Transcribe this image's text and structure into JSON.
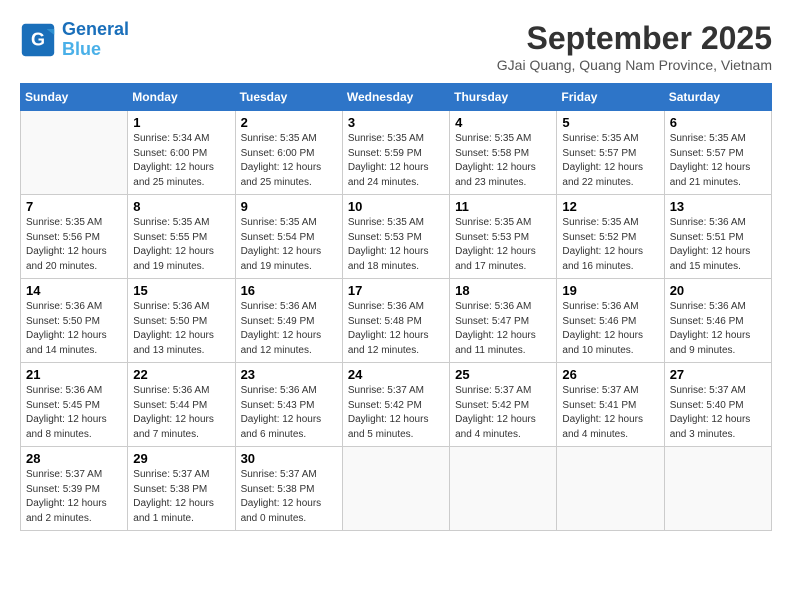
{
  "header": {
    "logo_line1": "General",
    "logo_line2": "Blue",
    "month_title": "September 2025",
    "subtitle": "GJai Quang, Quang Nam Province, Vietnam"
  },
  "days_of_week": [
    "Sunday",
    "Monday",
    "Tuesday",
    "Wednesday",
    "Thursday",
    "Friday",
    "Saturday"
  ],
  "weeks": [
    [
      {
        "day": "",
        "info": ""
      },
      {
        "day": "1",
        "info": "Sunrise: 5:34 AM\nSunset: 6:00 PM\nDaylight: 12 hours\nand 25 minutes."
      },
      {
        "day": "2",
        "info": "Sunrise: 5:35 AM\nSunset: 6:00 PM\nDaylight: 12 hours\nand 25 minutes."
      },
      {
        "day": "3",
        "info": "Sunrise: 5:35 AM\nSunset: 5:59 PM\nDaylight: 12 hours\nand 24 minutes."
      },
      {
        "day": "4",
        "info": "Sunrise: 5:35 AM\nSunset: 5:58 PM\nDaylight: 12 hours\nand 23 minutes."
      },
      {
        "day": "5",
        "info": "Sunrise: 5:35 AM\nSunset: 5:57 PM\nDaylight: 12 hours\nand 22 minutes."
      },
      {
        "day": "6",
        "info": "Sunrise: 5:35 AM\nSunset: 5:57 PM\nDaylight: 12 hours\nand 21 minutes."
      }
    ],
    [
      {
        "day": "7",
        "info": "Sunrise: 5:35 AM\nSunset: 5:56 PM\nDaylight: 12 hours\nand 20 minutes."
      },
      {
        "day": "8",
        "info": "Sunrise: 5:35 AM\nSunset: 5:55 PM\nDaylight: 12 hours\nand 19 minutes."
      },
      {
        "day": "9",
        "info": "Sunrise: 5:35 AM\nSunset: 5:54 PM\nDaylight: 12 hours\nand 19 minutes."
      },
      {
        "day": "10",
        "info": "Sunrise: 5:35 AM\nSunset: 5:53 PM\nDaylight: 12 hours\nand 18 minutes."
      },
      {
        "day": "11",
        "info": "Sunrise: 5:35 AM\nSunset: 5:53 PM\nDaylight: 12 hours\nand 17 minutes."
      },
      {
        "day": "12",
        "info": "Sunrise: 5:35 AM\nSunset: 5:52 PM\nDaylight: 12 hours\nand 16 minutes."
      },
      {
        "day": "13",
        "info": "Sunrise: 5:36 AM\nSunset: 5:51 PM\nDaylight: 12 hours\nand 15 minutes."
      }
    ],
    [
      {
        "day": "14",
        "info": "Sunrise: 5:36 AM\nSunset: 5:50 PM\nDaylight: 12 hours\nand 14 minutes."
      },
      {
        "day": "15",
        "info": "Sunrise: 5:36 AM\nSunset: 5:50 PM\nDaylight: 12 hours\nand 13 minutes."
      },
      {
        "day": "16",
        "info": "Sunrise: 5:36 AM\nSunset: 5:49 PM\nDaylight: 12 hours\nand 12 minutes."
      },
      {
        "day": "17",
        "info": "Sunrise: 5:36 AM\nSunset: 5:48 PM\nDaylight: 12 hours\nand 12 minutes."
      },
      {
        "day": "18",
        "info": "Sunrise: 5:36 AM\nSunset: 5:47 PM\nDaylight: 12 hours\nand 11 minutes."
      },
      {
        "day": "19",
        "info": "Sunrise: 5:36 AM\nSunset: 5:46 PM\nDaylight: 12 hours\nand 10 minutes."
      },
      {
        "day": "20",
        "info": "Sunrise: 5:36 AM\nSunset: 5:46 PM\nDaylight: 12 hours\nand 9 minutes."
      }
    ],
    [
      {
        "day": "21",
        "info": "Sunrise: 5:36 AM\nSunset: 5:45 PM\nDaylight: 12 hours\nand 8 minutes."
      },
      {
        "day": "22",
        "info": "Sunrise: 5:36 AM\nSunset: 5:44 PM\nDaylight: 12 hours\nand 7 minutes."
      },
      {
        "day": "23",
        "info": "Sunrise: 5:36 AM\nSunset: 5:43 PM\nDaylight: 12 hours\nand 6 minutes."
      },
      {
        "day": "24",
        "info": "Sunrise: 5:37 AM\nSunset: 5:42 PM\nDaylight: 12 hours\nand 5 minutes."
      },
      {
        "day": "25",
        "info": "Sunrise: 5:37 AM\nSunset: 5:42 PM\nDaylight: 12 hours\nand 4 minutes."
      },
      {
        "day": "26",
        "info": "Sunrise: 5:37 AM\nSunset: 5:41 PM\nDaylight: 12 hours\nand 4 minutes."
      },
      {
        "day": "27",
        "info": "Sunrise: 5:37 AM\nSunset: 5:40 PM\nDaylight: 12 hours\nand 3 minutes."
      }
    ],
    [
      {
        "day": "28",
        "info": "Sunrise: 5:37 AM\nSunset: 5:39 PM\nDaylight: 12 hours\nand 2 minutes."
      },
      {
        "day": "29",
        "info": "Sunrise: 5:37 AM\nSunset: 5:38 PM\nDaylight: 12 hours\nand 1 minute."
      },
      {
        "day": "30",
        "info": "Sunrise: 5:37 AM\nSunset: 5:38 PM\nDaylight: 12 hours\nand 0 minutes."
      },
      {
        "day": "",
        "info": ""
      },
      {
        "day": "",
        "info": ""
      },
      {
        "day": "",
        "info": ""
      },
      {
        "day": "",
        "info": ""
      }
    ]
  ]
}
